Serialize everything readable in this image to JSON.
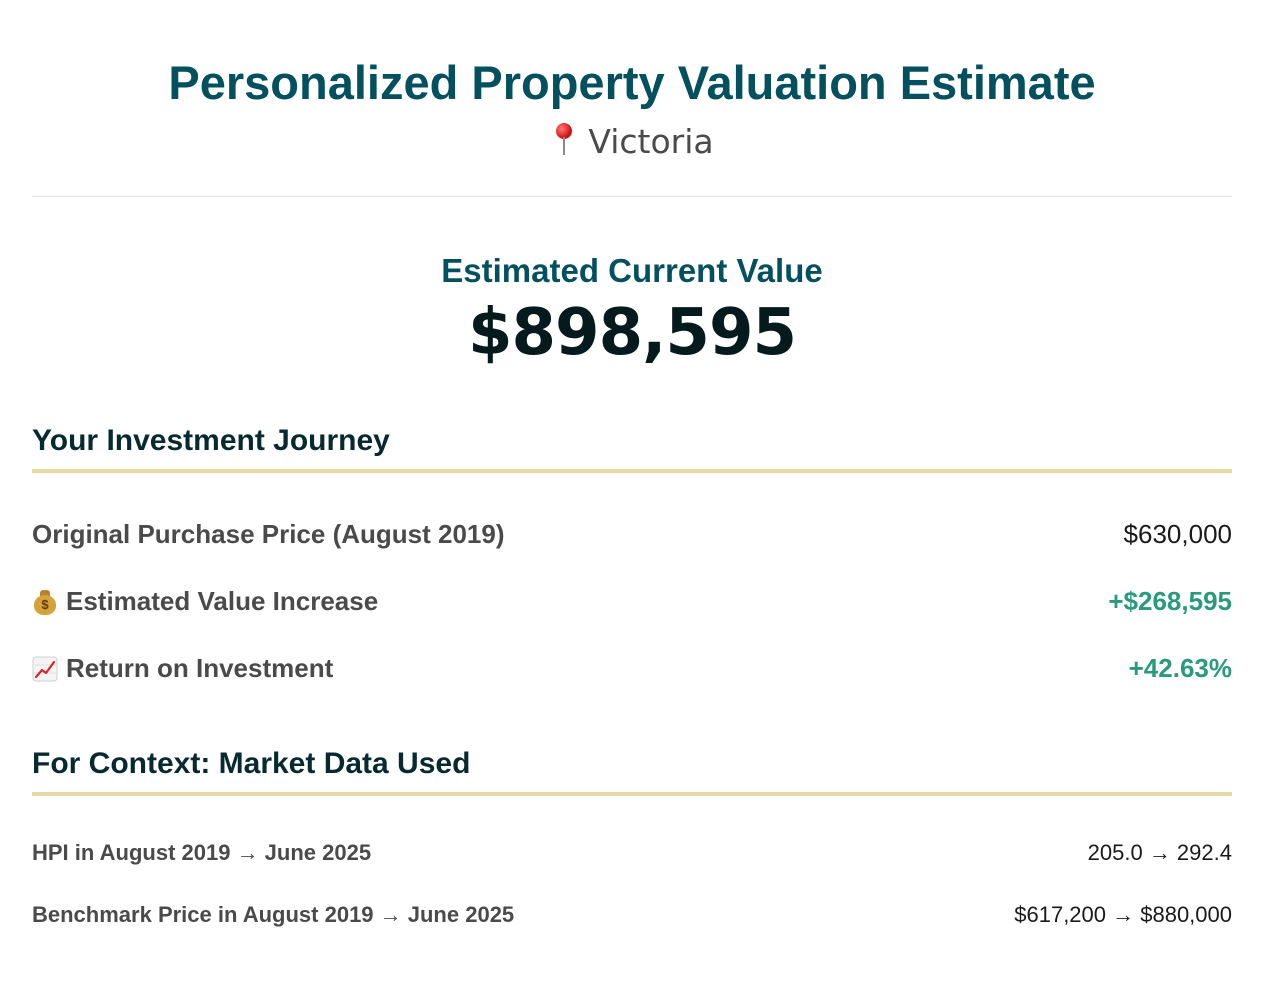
{
  "header": {
    "title": "Personalized Property Valuation Estimate",
    "location": "Victoria"
  },
  "valuation": {
    "label": "Estimated Current Value",
    "amount": "$898,595"
  },
  "journey": {
    "title": "Your Investment Journey",
    "rows": [
      {
        "label": "Original Purchase Price (August 2019)",
        "value": "$630,000",
        "icon": null
      },
      {
        "label": "Estimated Value Increase",
        "value": "+$268,595",
        "icon": "money-bag-icon"
      },
      {
        "label": "Return on Investment",
        "value": "+42.63%",
        "icon": "chart-increasing-icon"
      }
    ]
  },
  "market": {
    "title": "For Context: Market Data Used",
    "rows": [
      {
        "label": "HPI in August 2019 → June 2025",
        "value": "205.0 → 292.4"
      },
      {
        "label": "Benchmark Price in August 2019 → June 2025",
        "value": "$617,200 → $880,000"
      }
    ]
  },
  "colors": {
    "title": "#04505f",
    "section_heading": "#062a30",
    "accent_rule": "#e6d8a6",
    "positive": "#2a9a7c",
    "label": "#4a4a4a"
  }
}
